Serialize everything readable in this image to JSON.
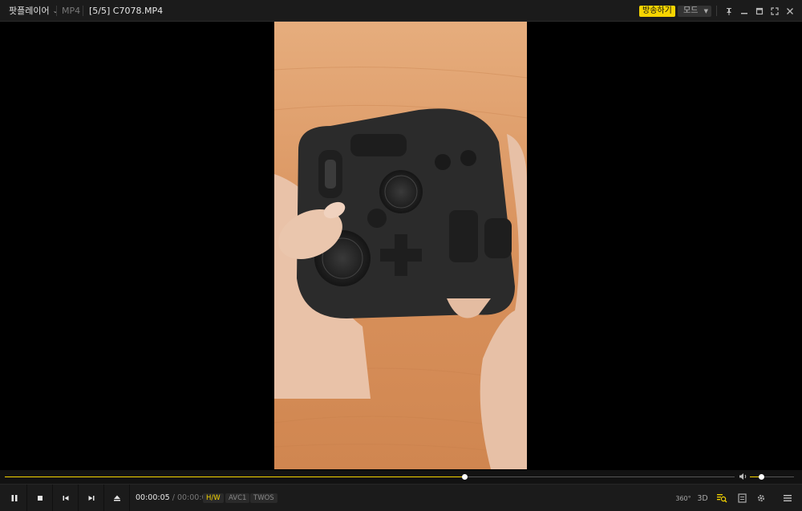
{
  "titlebar": {
    "app_menu_label": "팟플레이어",
    "format": "MP4",
    "playlist_position": "[5/5]",
    "file_name": "C7078.MP4",
    "broadcast_button": "방송하기",
    "mode_button": "모드"
  },
  "video": {
    "description_colors": {
      "wood": "#dd9a68",
      "device": "#2b2b2b"
    }
  },
  "seek": {
    "progress": 0.63
  },
  "volume": {
    "level": 0.25
  },
  "playback": {
    "current_time": "00:00:05",
    "separator": "/",
    "total_time": "00:00:09",
    "hw_tag": "H/W",
    "codec_tag": "AVC1",
    "audio_tag": "TWOS"
  },
  "right_controls": {
    "vr_label": "360°",
    "threed_label": "3D"
  },
  "colors": {
    "accent": "#f5d400",
    "bar": "#1b1b1b"
  }
}
